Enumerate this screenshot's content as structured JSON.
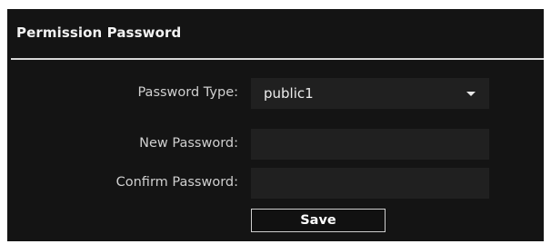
{
  "panel": {
    "title": "Permission Password"
  },
  "form": {
    "password_type": {
      "label": "Password Type:",
      "selected": "public1"
    },
    "new_password": {
      "label": "New Password:",
      "value": ""
    },
    "confirm_password": {
      "label": "Confirm Password:",
      "value": ""
    },
    "save_label": "Save"
  },
  "colors": {
    "panel_background": "#141414",
    "field_background": "#202020",
    "label_text": "#d0d0d0",
    "title_text": "#f2f2f2"
  },
  "icons": {
    "dropdown": "chevron-down-icon"
  }
}
